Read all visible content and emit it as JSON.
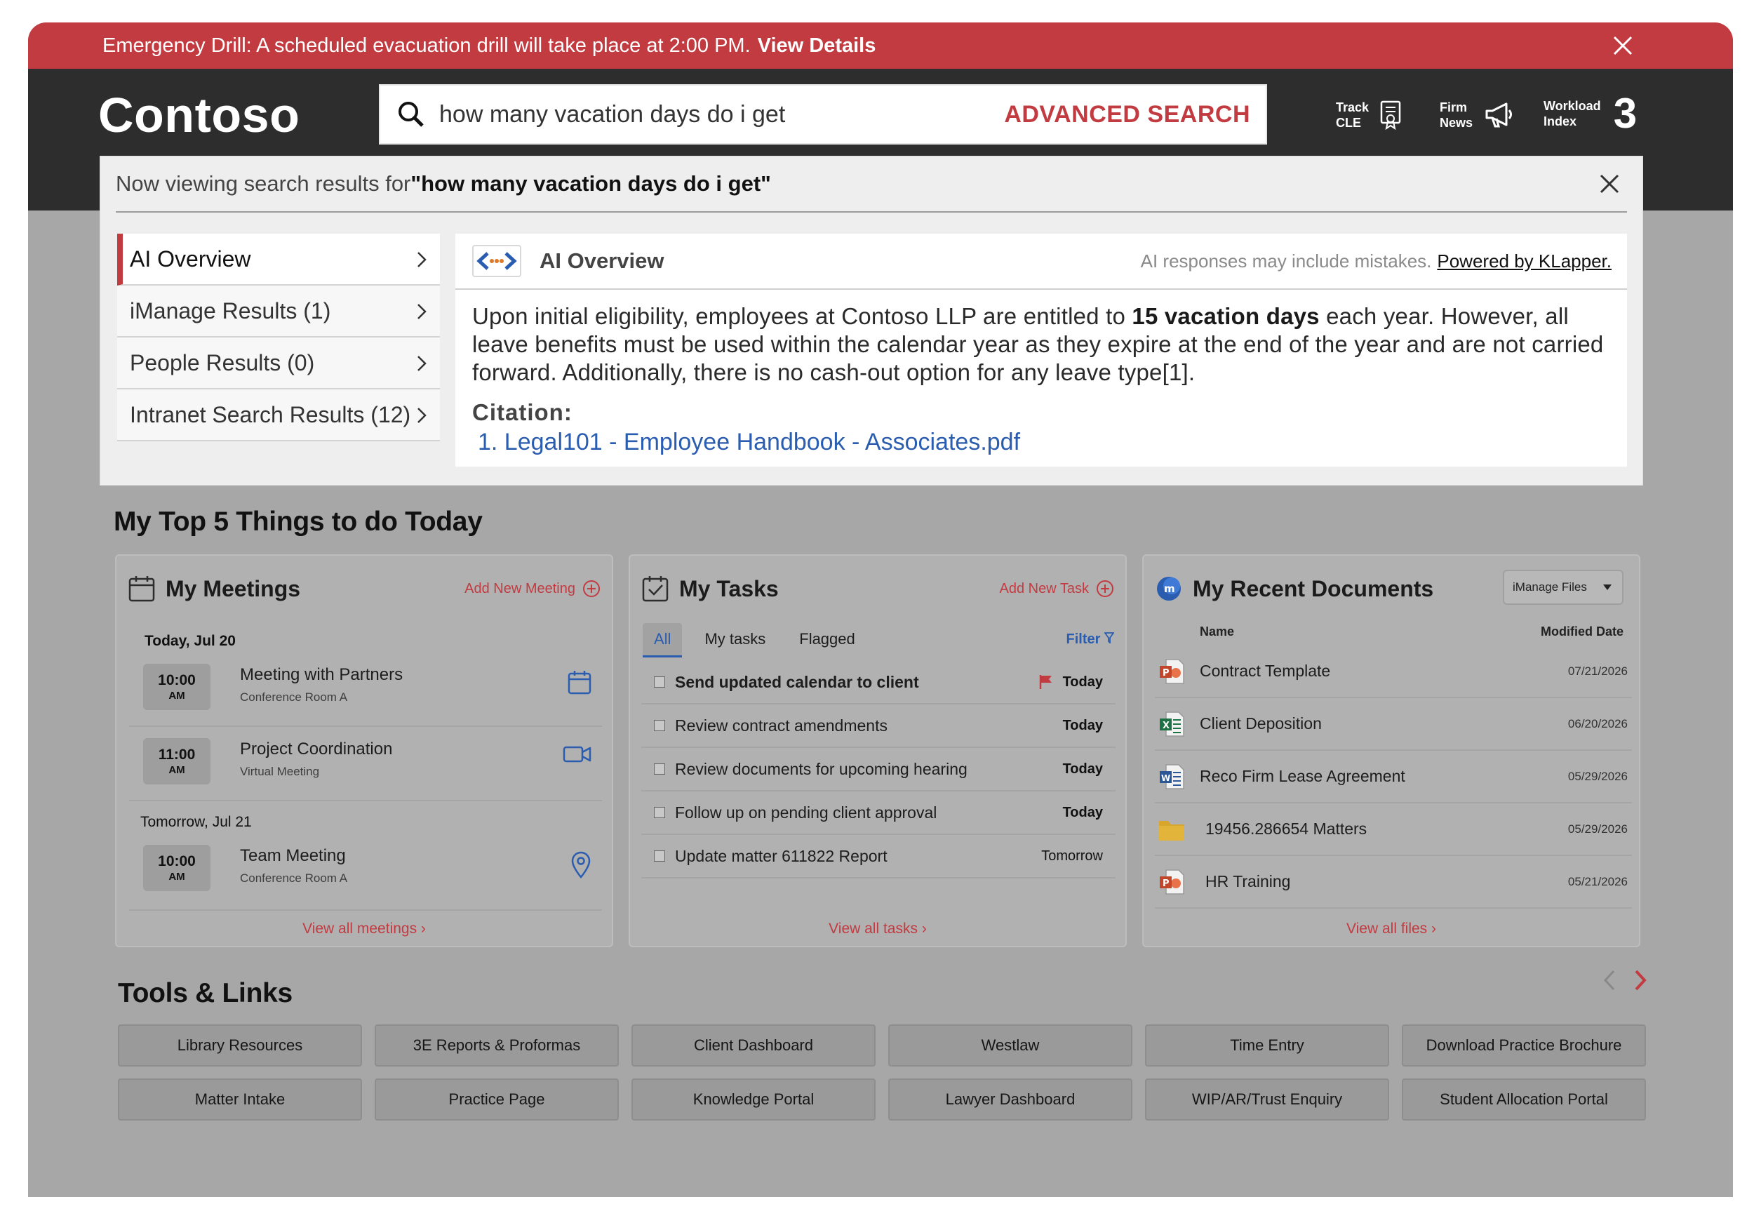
{
  "alert": {
    "message": "Emergency Drill: A scheduled evacuation drill will take place at 2:00 PM.",
    "link": "View Details"
  },
  "header": {
    "brand": "Contoso",
    "search_value": "how many vacation days do i get",
    "advanced_search": "ADVANCED SEARCH",
    "track_line1": "Track",
    "track_line2": "CLE",
    "news_line1": "Firm",
    "news_line2": "News",
    "workload_line1": "Workload",
    "workload_line2": "Index",
    "workload_value": "3"
  },
  "results": {
    "prefix": "Now viewing search results for ",
    "query": "\"how many vacation days do i get\"",
    "nav": [
      {
        "label": "AI Overview"
      },
      {
        "label": "iManage Results (1)"
      },
      {
        "label": "People Results (0)"
      },
      {
        "label": "Intranet Search Results (12)"
      }
    ],
    "overview": {
      "title": "AI Overview",
      "disclaimer": "AI responses may include mistakes.",
      "powered": "Powered by KLapper.",
      "text_before": "Upon initial eligibility, employees at Contoso LLP are entitled to ",
      "text_bold": "15 vacation days",
      "text_after": " each year. However, all leave benefits must be used within the calendar year as they expire at the end of the year and are not carried forward. Additionally, there is no cash-out option for any leave type[1].",
      "citation_label": "Citation:",
      "citation_link": "1. Legal101 - Employee Handbook - Associates.pdf"
    }
  },
  "top5": {
    "title": "My Top 5 Things to do Today"
  },
  "meetings": {
    "title": "My Meetings",
    "add": "Add New Meeting",
    "today_label": "Today, Jul 20",
    "tomorrow_label": "Tomorrow, Jul 21",
    "items": [
      {
        "time": "10:00",
        "ampm": "AM",
        "title": "Meeting with Partners",
        "location": "Conference Room A",
        "icon": "calendar-icon"
      },
      {
        "time": "11:00",
        "ampm": "AM",
        "title": "Project Coordination",
        "location": "Virtual Meeting",
        "icon": "video-camera-icon"
      },
      {
        "time": "10:00",
        "ampm": "AM",
        "title": "Team Meeting",
        "location": "Conference Room A",
        "icon": "map-pin-icon"
      }
    ],
    "footer": "View all meetings"
  },
  "tasks": {
    "title": "My Tasks",
    "add": "Add New Task",
    "tabs": [
      "All",
      "My tasks",
      "Flagged"
    ],
    "filter": "Filter",
    "items": [
      {
        "title": "Send updated calendar to client",
        "due": "Today",
        "flagged": true
      },
      {
        "title": "Review contract amendments",
        "due": "Today",
        "flagged": false
      },
      {
        "title": "Review documents for upcoming hearing",
        "due": "Today",
        "flagged": false
      },
      {
        "title": "Follow up on pending client approval",
        "due": "Today",
        "flagged": false
      },
      {
        "title": "Update matter 611822 Report",
        "due": "Tomorrow",
        "flagged": false
      }
    ],
    "footer": "View all tasks"
  },
  "documents": {
    "title": "My Recent Documents",
    "source": "iManage Files",
    "col_name": "Name",
    "col_date": "Modified Date",
    "items": [
      {
        "name": "Contract Template",
        "date": "07/21/2026",
        "type": "powerpoint-icon"
      },
      {
        "name": "Client Deposition",
        "date": "06/20/2026",
        "type": "excel-icon"
      },
      {
        "name": "Reco Firm Lease Agreement",
        "date": "05/29/2026",
        "type": "word-icon"
      },
      {
        "name": "19456.286654 Matters",
        "date": "05/29/2026",
        "type": "folder-icon"
      },
      {
        "name": "HR Training",
        "date": "05/21/2026",
        "type": "powerpoint-icon"
      }
    ],
    "footer": "View all files"
  },
  "tools": {
    "title": "Tools & Links",
    "links": [
      "Library Resources",
      "3E Reports & Proformas",
      "Client Dashboard",
      "Westlaw",
      "Time Entry",
      "Download Practice Brochure",
      "Matter Intake",
      "Practice Page",
      "Knowledge Portal",
      "Lawyer Dashboard",
      "WIP/AR/Trust Enquiry",
      "Student Allocation Portal"
    ]
  },
  "colors": {
    "accent": "#c23b41",
    "header": "#2d2d2d",
    "link": "#2a5db0",
    "background": "#a7a7a7"
  }
}
